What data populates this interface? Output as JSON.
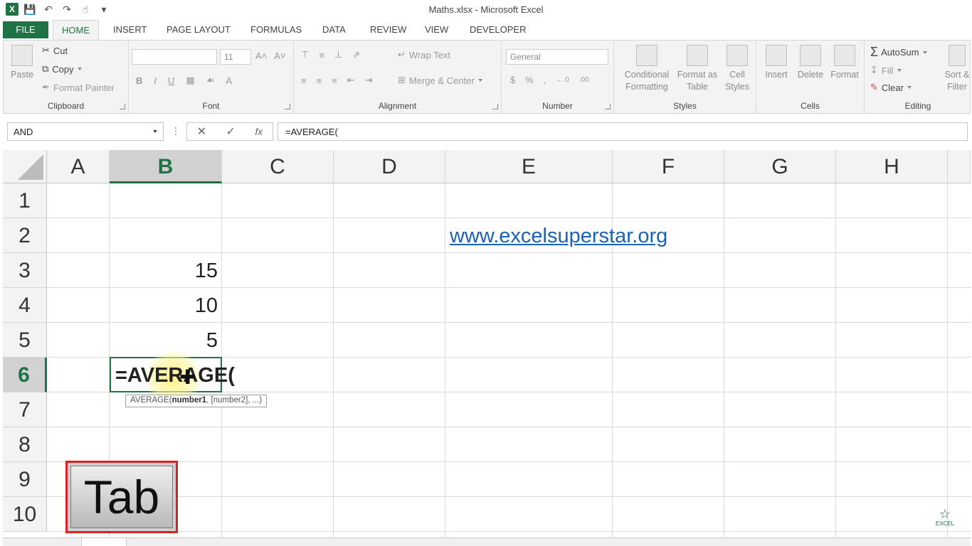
{
  "window": {
    "title": "Maths.xlsx - Microsoft Excel"
  },
  "ribbon_tabs": [
    "FILE",
    "HOME",
    "INSERT",
    "PAGE LAYOUT",
    "FORMULAS",
    "DATA",
    "REVIEW",
    "VIEW",
    "DEVELOPER"
  ],
  "clipboard": {
    "paste": "Paste",
    "cut": "Cut",
    "copy": "Copy",
    "format_painter": "Format Painter",
    "label": "Clipboard"
  },
  "font": {
    "name": "",
    "size": "11",
    "label": "Font",
    "bold": "B",
    "italic": "I",
    "underline": "U"
  },
  "alignment": {
    "wrap_text": "Wrap Text",
    "merge_center": "Merge & Center",
    "label": "Alignment"
  },
  "number": {
    "format": "General",
    "currency": "$",
    "percent": "%",
    "comma": ",",
    "label": "Number"
  },
  "styles": {
    "conditional_1": "Conditional",
    "conditional_2": "Formatting",
    "format_as_1": "Format as",
    "format_as_2": "Table",
    "cell_styles_1": "Cell",
    "cell_styles_2": "Styles",
    "label": "Styles"
  },
  "cells": {
    "insert": "Insert",
    "delete": "Delete",
    "format": "Format",
    "label": "Cells"
  },
  "editing": {
    "autosum": "AutoSum",
    "fill": "Fill",
    "clear": "Clear",
    "sort_1": "Sort &",
    "sort_2": "Filter",
    "label": "Editing"
  },
  "formula_bar": {
    "name_box": "AND",
    "formula": "=AVERAGE("
  },
  "columns": [
    "A",
    "B",
    "C",
    "D",
    "E",
    "F",
    "G",
    "H"
  ],
  "rows": [
    "1",
    "2",
    "3",
    "4",
    "5",
    "6",
    "7",
    "8",
    "9",
    "10"
  ],
  "cells_data": {
    "B3": "15",
    "B4": "10",
    "B5": "5",
    "E2": "www.excelsuperstar.org"
  },
  "active_cell": {
    "address": "B6",
    "editing_text": "=AVERAGE("
  },
  "tooltip": {
    "func": "AVERAGE(",
    "arg1": "number1",
    "rest": ", [number2], ...)"
  },
  "overlay": {
    "key_label": "Tab"
  },
  "watermark": {
    "text": "EXCEL"
  },
  "colors": {
    "accent": "#217346",
    "link": "#1a62b8",
    "key_border": "#e02020"
  }
}
